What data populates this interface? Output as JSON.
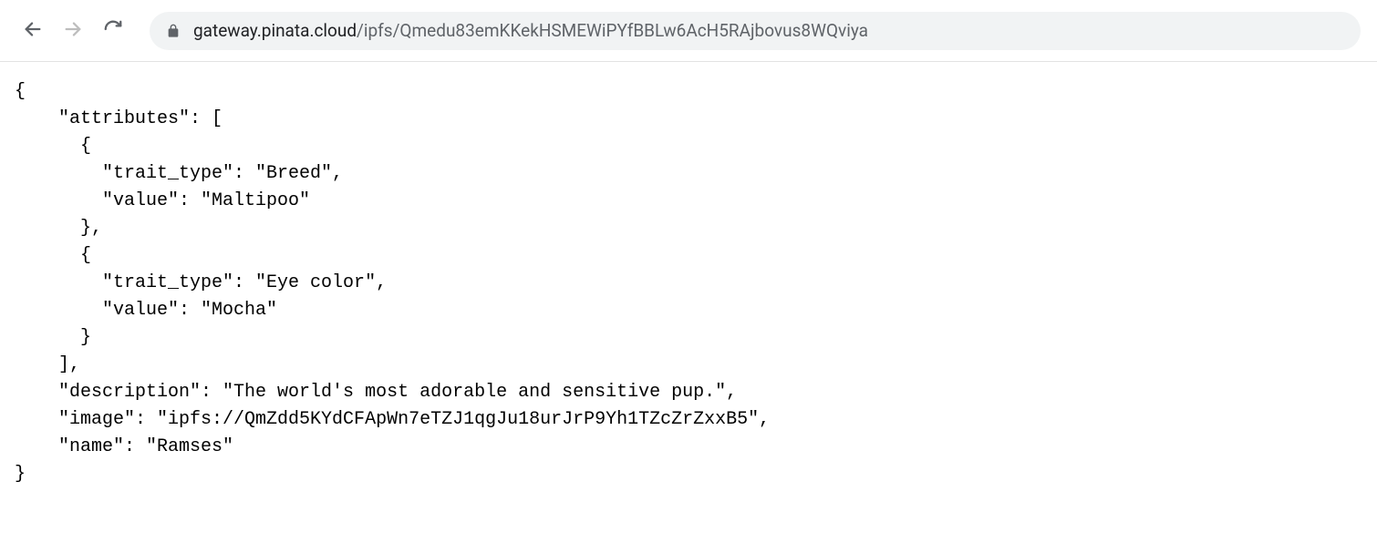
{
  "url": {
    "domain": "gateway.pinata.cloud",
    "path": "/ipfs/Qmedu83emKKekHSMEWiPYfBBLw6AcH5RAjbovus8WQviya"
  },
  "json_content": {
    "line1": "{",
    "line2": "    \"attributes\": [",
    "line3": "      {",
    "line4": "        \"trait_type\": \"Breed\",",
    "line5": "        \"value\": \"Maltipoo\"",
    "line6": "      },",
    "line7": "      {",
    "line8": "        \"trait_type\": \"Eye color\",",
    "line9": "        \"value\": \"Mocha\"",
    "line10": "      }",
    "line11": "    ],",
    "line12": "    \"description\": \"The world's most adorable and sensitive pup.\",",
    "line13": "    \"image\": \"ipfs://QmZdd5KYdCFApWn7eTZJ1qgJu18urJrP9Yh1TZcZrZxxB5\",",
    "line14": "    \"name\": \"Ramses\"",
    "line15": "}"
  }
}
